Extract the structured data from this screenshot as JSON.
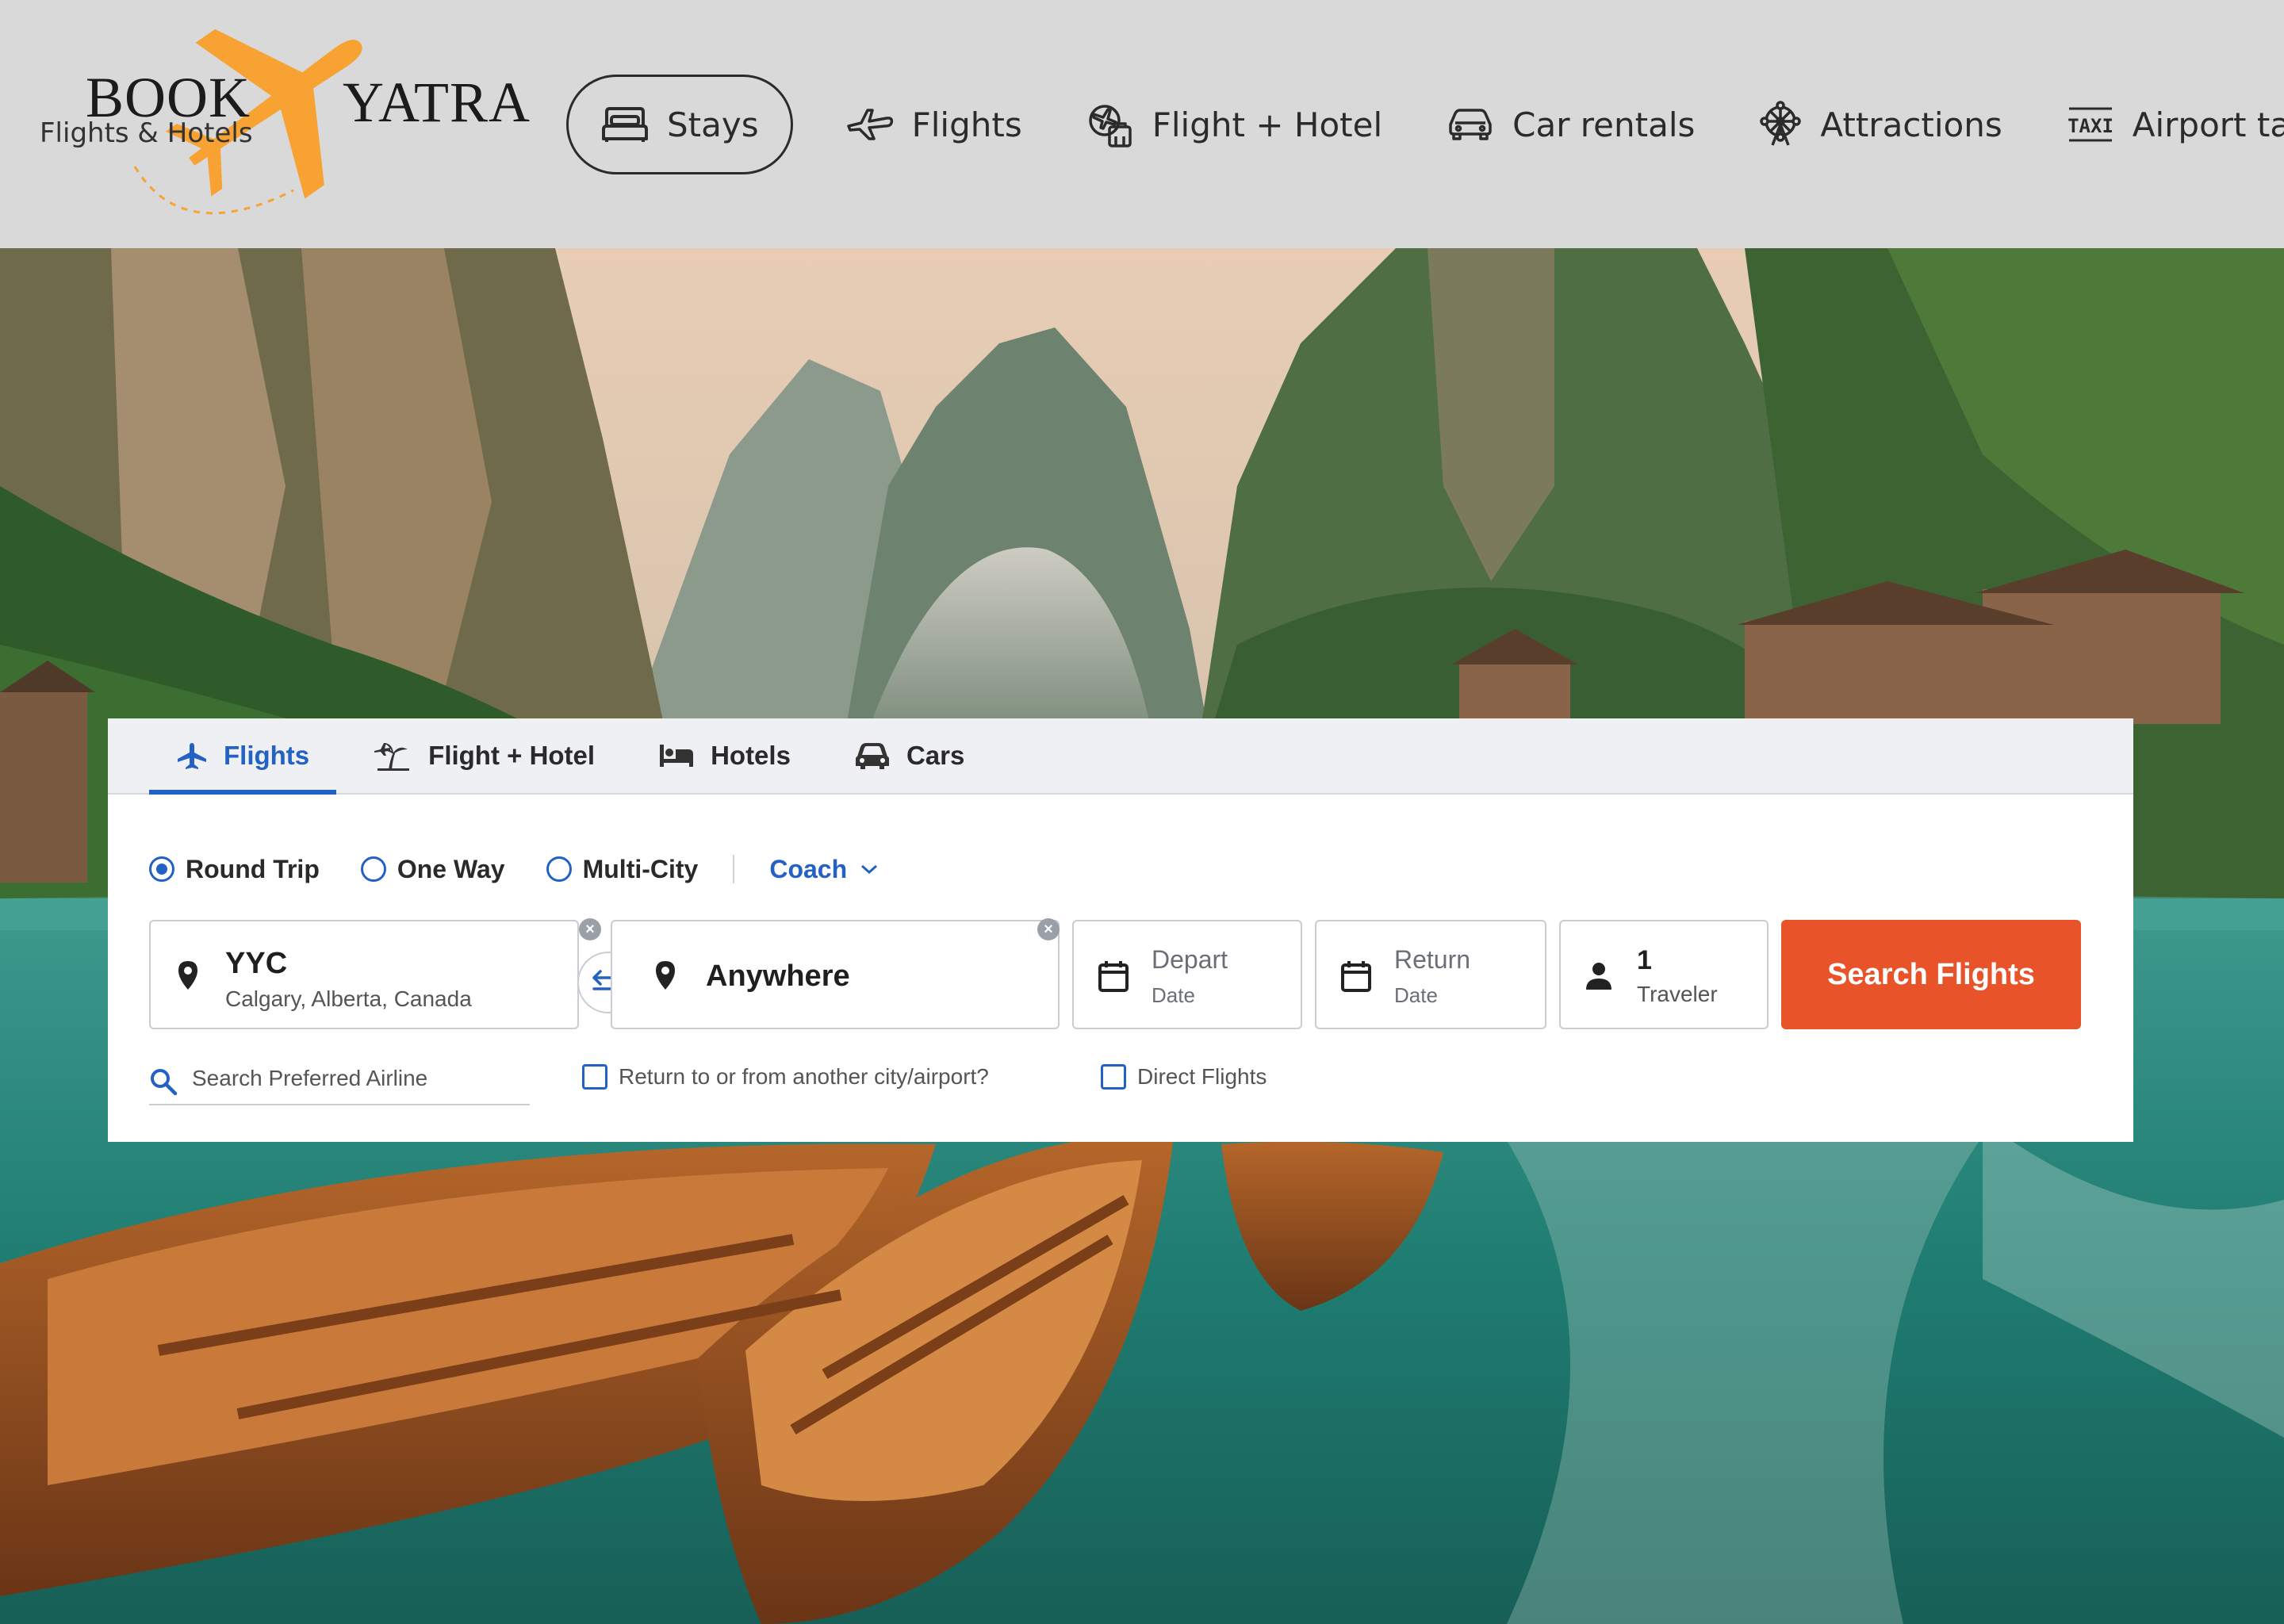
{
  "brand": {
    "name_left": "BOOK",
    "name_right": "YATRA",
    "tagline": "Flights & Hotels",
    "accent_color": "#f7a233"
  },
  "nav": {
    "items": [
      {
        "label": "Stays",
        "icon": "bed-icon",
        "active": true
      },
      {
        "label": "Flights",
        "icon": "plane-icon",
        "active": false
      },
      {
        "label": "Flight + Hotel",
        "icon": "flight-hotel-icon",
        "active": false
      },
      {
        "label": "Car rentals",
        "icon": "car-icon",
        "active": false
      },
      {
        "label": "Attractions",
        "icon": "ferris-wheel-icon",
        "active": false
      },
      {
        "label": "Airport taxis",
        "icon": "taxi-icon",
        "active": false
      }
    ]
  },
  "search": {
    "tabs": [
      {
        "label": "Flights",
        "icon": "plane-icon",
        "active": true
      },
      {
        "label": "Flight + Hotel",
        "icon": "palm-plane-icon",
        "active": false
      },
      {
        "label": "Hotels",
        "icon": "bed-icon",
        "active": false
      },
      {
        "label": "Cars",
        "icon": "car-icon",
        "active": false
      }
    ],
    "trip_types": [
      {
        "label": "Round Trip",
        "selected": true
      },
      {
        "label": "One Way",
        "selected": false
      },
      {
        "label": "Multi-City",
        "selected": false
      }
    ],
    "cabin_class": "Coach",
    "from": {
      "code": "YYC",
      "city": "Calgary, Alberta, Canada"
    },
    "to": {
      "value": "Anywhere"
    },
    "depart": {
      "label": "Depart",
      "sub": "Date"
    },
    "return": {
      "label": "Return",
      "sub": "Date"
    },
    "travelers": {
      "count": "1",
      "label": "Traveler"
    },
    "search_button": "Search Flights",
    "airline_placeholder": "Search Preferred Airline",
    "return_other_city_label": "Return to or from another city/airport?",
    "direct_flights_label": "Direct Flights",
    "accent_color": "#2361c4",
    "button_color": "#e8532a"
  }
}
